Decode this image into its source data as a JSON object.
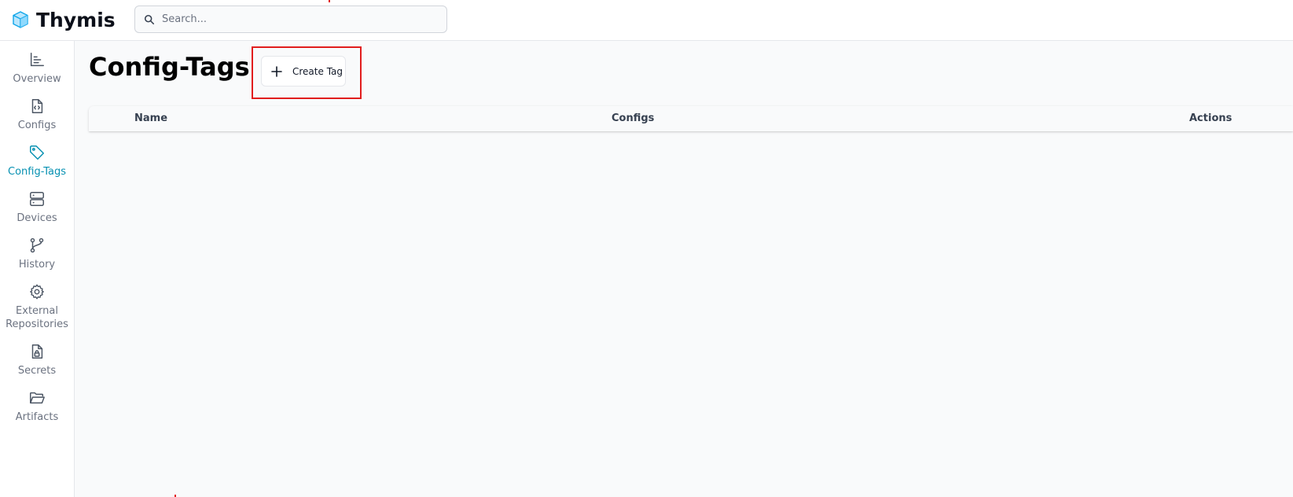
{
  "app": {
    "name": "Thymis",
    "brand_color": "#0891b2",
    "logo_icon": "thymis-logo-icon"
  },
  "search": {
    "placeholder": "Search...",
    "value": "",
    "icon": "search-icon"
  },
  "sidebar": {
    "items": [
      {
        "label": "Overview",
        "icon": "chart-bar-icon",
        "active": false
      },
      {
        "label": "Configs",
        "icon": "file-code-icon",
        "active": false
      },
      {
        "label": "Config-Tags",
        "icon": "tag-icon",
        "active": true
      },
      {
        "label": "Devices",
        "icon": "server-icon",
        "active": false
      },
      {
        "label": "History",
        "icon": "git-branch-icon",
        "active": false
      },
      {
        "label": "External Repositories",
        "icon": "gear-icon",
        "active": false
      },
      {
        "label": "Secrets",
        "icon": "file-lock-icon",
        "active": false
      },
      {
        "label": "Artifacts",
        "icon": "folder-open-icon",
        "active": false
      }
    ]
  },
  "main": {
    "title": "Config-Tags",
    "create_button": {
      "label": "Create Tag",
      "icon": "plus-icon"
    },
    "table": {
      "columns": [
        "Name",
        "Configs",
        "Actions"
      ],
      "rows": []
    }
  },
  "annotation_color": "#e11d1d"
}
